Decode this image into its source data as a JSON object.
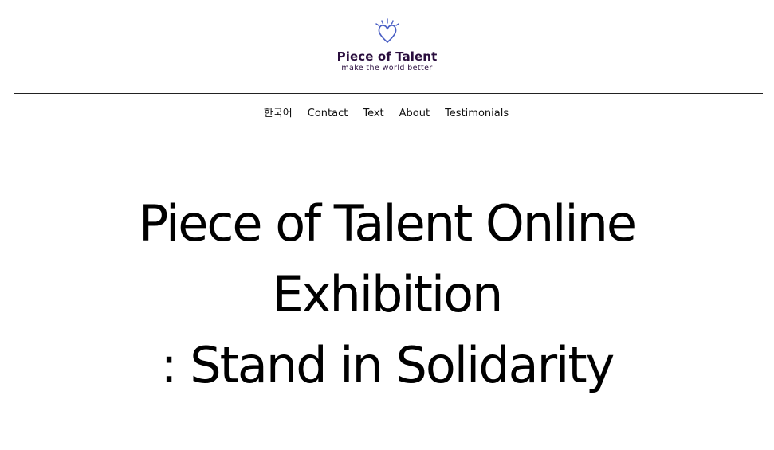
{
  "header": {
    "logo": {
      "icon": "heart-icon",
      "name": "Piece of Talent",
      "tagline": "make the world better",
      "color": "#2a0e3e",
      "icon_color": "#4a5fc4"
    }
  },
  "nav": {
    "items": [
      {
        "label": "한국어",
        "name": "nav-item-korean"
      },
      {
        "label": "Contact",
        "name": "nav-item-contact"
      },
      {
        "label": "Text",
        "name": "nav-item-text"
      },
      {
        "label": "About",
        "name": "nav-item-about"
      },
      {
        "label": "Testimonials",
        "name": "nav-item-testimonials"
      }
    ]
  },
  "hero": {
    "title_lines": [
      "Piece of Talent Online",
      "Exhibition",
      ": Stand in Solidarity"
    ]
  }
}
